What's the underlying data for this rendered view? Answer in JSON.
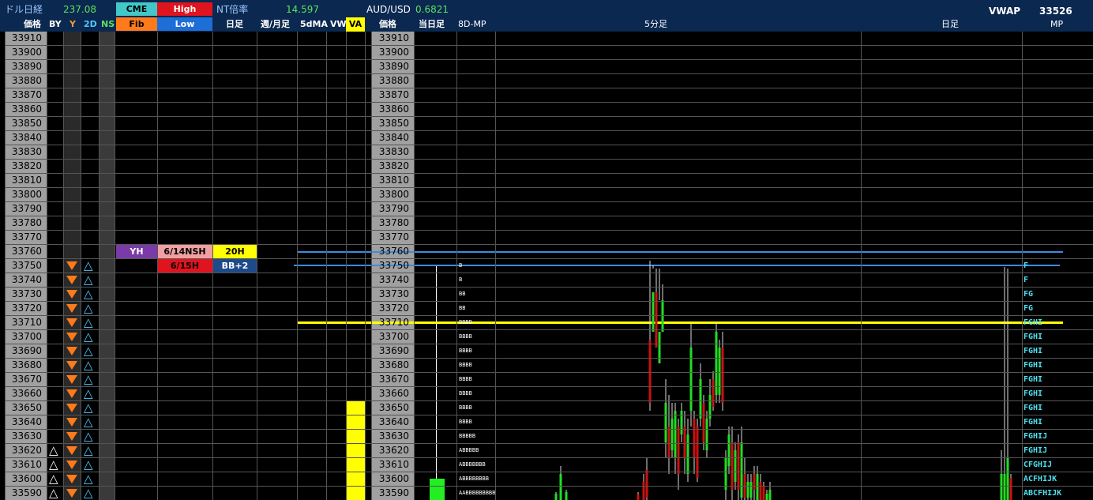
{
  "header": {
    "title": "ドル日経",
    "title_value": "237.08",
    "cme_label": "CME",
    "high_label": "High",
    "fib_label": "Fib",
    "low_label": "Low",
    "nt_label": "NT倍率",
    "nt_value": "14.597",
    "audusd_label": "AUD/USD",
    "audusd_value": "0.6821",
    "vwap_label": "VWAP",
    "vwap_value": "33526"
  },
  "columns": {
    "price": "価格",
    "by": "BY",
    "y": "Y",
    "d2": "2D",
    "ns": "NS",
    "daily": "日足",
    "weekly_monthly": "週/月足",
    "ma5d": "5dMA",
    "vw": "VW",
    "va": "VA",
    "price2": "価格",
    "today_daily": "当日足",
    "mp8d": "8D-MP",
    "min5": "5分足",
    "daily2": "日足",
    "mp": "MP"
  },
  "prices": [
    "33910",
    "33900",
    "33890",
    "33880",
    "33870",
    "33860",
    "33850",
    "33840",
    "33830",
    "33820",
    "33810",
    "33800",
    "33790",
    "33780",
    "33770",
    "33760",
    "33750",
    "33740",
    "33730",
    "33720",
    "33710",
    "33700",
    "33690",
    "33680",
    "33670",
    "33660",
    "33650",
    "33640",
    "33630",
    "33620",
    "33610",
    "33600",
    "33590"
  ],
  "labels": {
    "yh": "YH",
    "nsh": "6/14NSH",
    "h20": "20H",
    "h15": "6/15H",
    "bb2": "BB+2"
  },
  "mp8d": [
    "",
    "",
    "",
    "",
    "",
    "",
    "",
    "",
    "",
    "",
    "",
    "",
    "",
    "",
    "",
    "",
    "B",
    "B",
    "BB",
    "BB",
    "BBBB",
    "BBBB",
    "BBBB",
    "BBBB",
    "BBBB",
    "BBBB",
    "BBBB",
    "BBBB",
    "BBBBB",
    "ABBBBB",
    "ABBBBBBB",
    "ABBBBBBBB",
    "AABBBBBBBBB"
  ],
  "mp_right": [
    "",
    "",
    "",
    "",
    "",
    "",
    "",
    "",
    "",
    "",
    "",
    "",
    "",
    "",
    "",
    "",
    "F",
    "F",
    "FG",
    "FG",
    "FGHI",
    "FGHI",
    "FGHI",
    "FGHI",
    "FGHI",
    "FGHI",
    "FGHI",
    "FGHI",
    "FGHIJ",
    "FGHIJ",
    "CFGHIJ",
    "ACFHIJK",
    "ABCFHIJK"
  ],
  "colors": {
    "header_bg": "#0a2850",
    "price_col": "#a0a0a0",
    "tick_yellow": "#ffff00",
    "line_blue": "#3c8ce0",
    "candle_up": "#22dd22",
    "candle_down": "#cc1111"
  }
}
